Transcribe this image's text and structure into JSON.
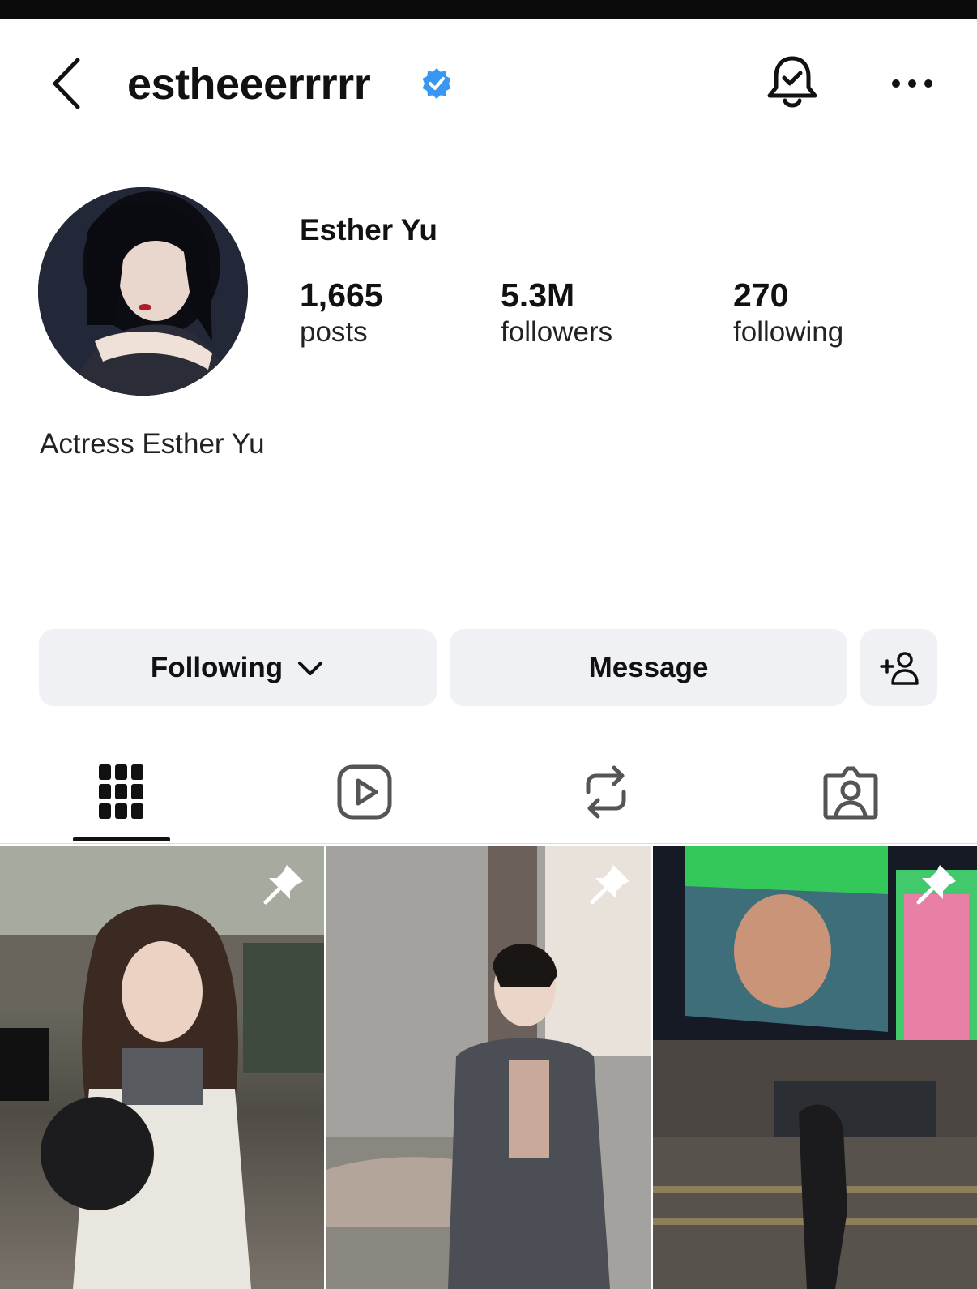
{
  "header": {
    "username": "estheeerrrrr",
    "icons": {
      "back": "chevron-left-icon",
      "verified": "verified-badge-icon",
      "notifications": "bell-check-icon",
      "more": "more-horizontal-icon"
    }
  },
  "profile": {
    "display_name": "Esther Yu",
    "bio": "Actress Esther Yu",
    "stats": [
      {
        "value": "1,665",
        "label": "posts"
      },
      {
        "value": "5.3M",
        "label": "followers"
      },
      {
        "value": "270",
        "label": "following"
      }
    ]
  },
  "actions": {
    "following_label": "Following",
    "message_label": "Message",
    "add_icon": "add-person-icon"
  },
  "tabs": [
    {
      "name": "posts-grid",
      "icon": "grid-icon",
      "active": true
    },
    {
      "name": "reels",
      "icon": "reels-icon",
      "active": false
    },
    {
      "name": "reposts",
      "icon": "repost-icon",
      "active": false
    },
    {
      "name": "tagged",
      "icon": "tagged-person-icon",
      "active": false
    }
  ],
  "grid": [
    {
      "pinned": true
    },
    {
      "pinned": true
    },
    {
      "pinned": true
    }
  ],
  "colors": {
    "verified": "#3897f0",
    "button_bg": "#eff1f4",
    "text": "#111111"
  }
}
